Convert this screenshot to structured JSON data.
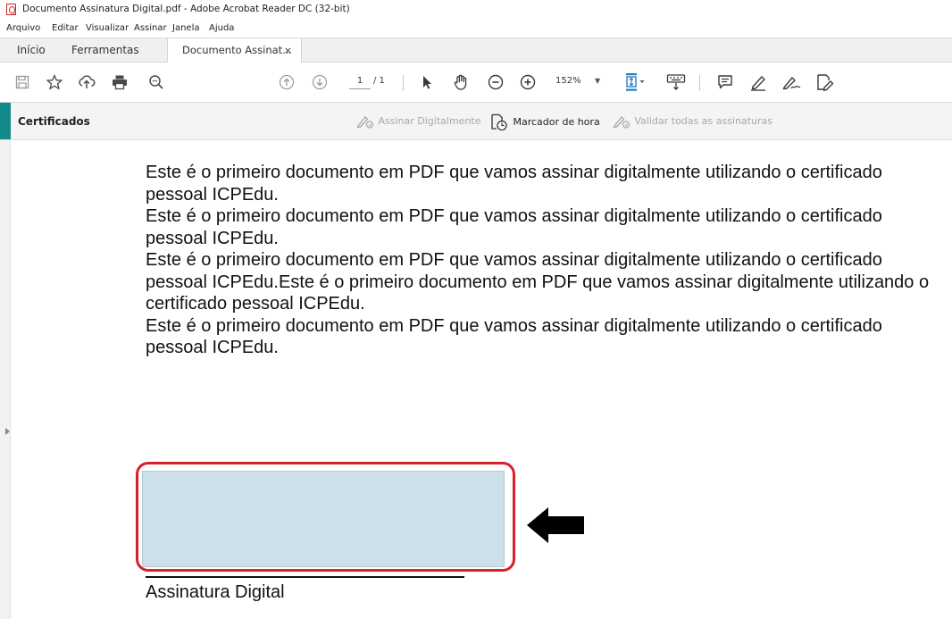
{
  "window": {
    "title": "Documento Assinatura Digital.pdf - Adobe Acrobat Reader DC (32-bit)"
  },
  "menu": {
    "items": [
      "Arquivo",
      "Editar",
      "Visualizar",
      "Assinar",
      "Janela",
      "Ajuda"
    ]
  },
  "tabs": {
    "home": "Início",
    "tools": "Ferramentas",
    "document": "Documento Assinat...",
    "close": "×"
  },
  "toolbar": {
    "icons": [
      "save-icon",
      "bookmark-star-icon",
      "upload-icon",
      "print-icon",
      "search-icon",
      "page-up-icon",
      "page-down-icon",
      "select-cursor-icon",
      "hand-icon",
      "zoom-out-icon",
      "zoom-in-icon",
      "fit-page-icon",
      "keyboard-icon",
      "comment-icon",
      "highlight-pen-icon",
      "sign-icon",
      "fill-sign-icon"
    ],
    "page_current": "1",
    "page_total": "/ 1",
    "zoom": "152%"
  },
  "cert_bar": {
    "title": "Certificados",
    "sign_digitally": "Assinar Digitalmente",
    "timestamp": "Marcador de hora",
    "validate_all": "Validar todas as assinaturas",
    "colors": {
      "accent": "#138a8a",
      "disabled_text": "#a8a8a8",
      "enabled_text": "#222222"
    }
  },
  "document": {
    "paragraphs": [
      "Este é o primeiro documento em PDF que vamos assinar digitalmente utilizando o certificado pessoal ICPEdu.",
      "Este é o primeiro documento em PDF que vamos assinar digitalmente utilizando o certificado pessoal ICPEdu.",
      "Este é o primeiro documento em PDF que vamos assinar digitalmente utilizando o certificado pessoal ICPEdu.Este é o primeiro documento em PDF que vamos assinar digitalmente utilizando o certificado pessoal ICPEdu.",
      "Este é o primeiro documento em PDF que vamos assinar digitalmente utilizando o certificado pessoal ICPEdu."
    ],
    "signature_label": "Assinatura Digital",
    "colors": {
      "highlight": "#d81f2a",
      "field_fill": "#cde0ea"
    }
  }
}
